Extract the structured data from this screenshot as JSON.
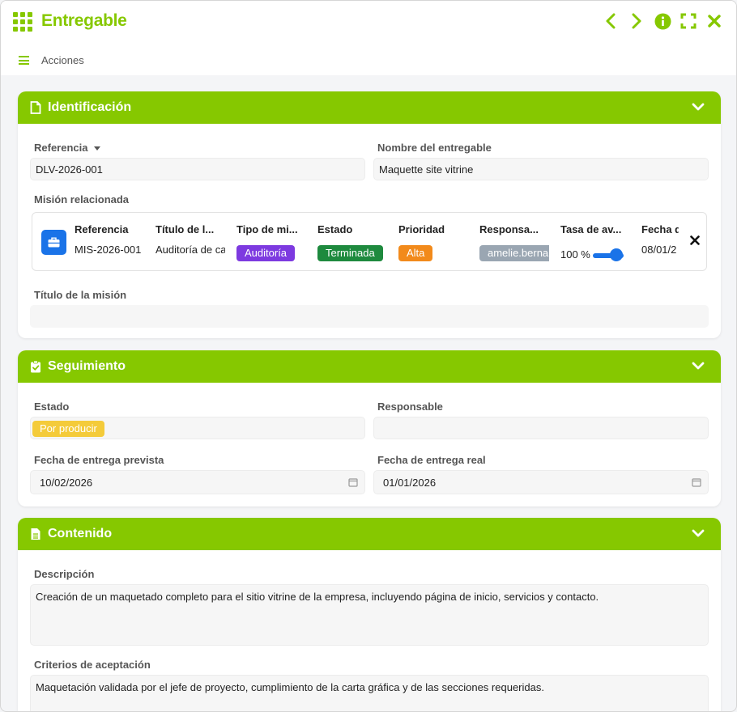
{
  "window": {
    "title": "Entregable",
    "controls": [
      "chevron-left-icon",
      "chevron-right-icon",
      "info-icon",
      "fullscreen-icon",
      "close-icon"
    ]
  },
  "actions": {
    "label": "Acciones"
  },
  "colors": {
    "accent": "#86c800",
    "blue": "#1a73e8"
  },
  "identificacion": {
    "title": "Identificación",
    "referencia_label": "Referencia",
    "referencia_value": "DLV-2026-001",
    "nombre_label": "Nombre del entregable",
    "nombre_value": "Maquette site vitrine",
    "mision_label": "Misión relacionada",
    "mision": {
      "columns": [
        "Referencia",
        "Título de l...",
        "Tipo de mi...",
        "Estado",
        "Prioridad",
        "Responsa...",
        "Tasa de av...",
        "Fecha d"
      ],
      "referencia": "MIS-2026-001",
      "titulo": "Auditoría de ca",
      "tipo": "Auditoría",
      "estado": "Terminada",
      "prioridad": "Alta",
      "responsable": "amelie.bernard",
      "tasa": "100 %",
      "tasa_level": 1.0,
      "fecha": "08/01/2"
    },
    "titulo_mision_label": "Título de la misión",
    "titulo_mision_value": ""
  },
  "seguimiento": {
    "title": "Seguimiento",
    "estado_label": "Estado",
    "estado_value": "Por producir",
    "responsable_label": "Responsable",
    "responsable_value": "",
    "fecha_prevista_label": "Fecha de entrega prevista",
    "fecha_prevista_value": "10/02/2026",
    "fecha_real_label": "Fecha de entrega real",
    "fecha_real_value": "01/01/2026"
  },
  "contenido": {
    "title": "Contenido",
    "descripcion_label": "Descripción",
    "descripcion_value": "Creación de un maquetado completo para el sitio vitrine de la empresa, incluyendo página de inicio, servicios y contacto.",
    "criterios_label": "Criterios de aceptación",
    "criterios_value": "Maquetación validada por el jefe de proyecto, cumplimiento de la carta gráfica y de las secciones requeridas."
  }
}
